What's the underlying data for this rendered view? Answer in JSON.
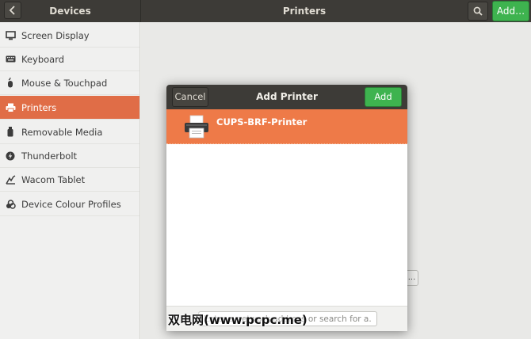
{
  "headerbar": {
    "back_icon": "chevron-left-icon",
    "left_title": "Devices",
    "title": "Printers",
    "search_icon": "search-icon",
    "add_label": "Add…",
    "accent_color": "#3eb34f"
  },
  "sidebar": {
    "active_color": "#e06d47",
    "items": [
      {
        "label": "Screen Display",
        "icon": "display-icon"
      },
      {
        "label": "Keyboard",
        "icon": "keyboard-icon"
      },
      {
        "label": "Mouse & Touchpad",
        "icon": "mouse-icon"
      },
      {
        "label": "Printers",
        "icon": "printer-icon",
        "active": true
      },
      {
        "label": "Removable Media",
        "icon": "usb-media-icon"
      },
      {
        "label": "Thunderbolt",
        "icon": "thunderbolt-icon"
      },
      {
        "label": "Wacom Tablet",
        "icon": "tablet-icon"
      },
      {
        "label": "Device Colour Profiles",
        "icon": "colour-profiles-icon"
      }
    ]
  },
  "main": {
    "more_button_label": "..."
  },
  "dialog": {
    "cancel_label": "Cancel",
    "title": "Add Printer",
    "add_label": "Add",
    "selected_color": "#ee7a48",
    "printers": [
      {
        "name": "CUPS-BRF-Printer",
        "icon": "printer-icon",
        "selected": true
      }
    ],
    "search_placeholder": "Enter a network address or search for a..."
  },
  "watermark": {
    "text": "双电网(www.pcpc.me)"
  }
}
